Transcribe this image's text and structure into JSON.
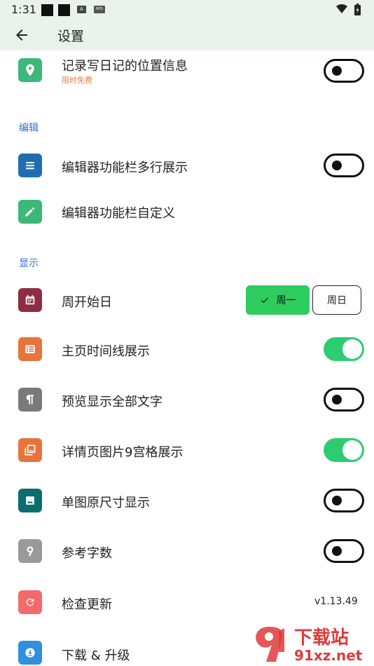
{
  "status": {
    "time": "1:31",
    "a_badge": "A",
    "rps_badge": "RPS"
  },
  "appbar": {
    "title": "设置"
  },
  "items": [
    {
      "label": "记录写日记的位置信息",
      "sub": "限时免费"
    },
    {
      "label": "编辑器功能栏多行展示"
    },
    {
      "label": "编辑器功能栏自定义"
    },
    {
      "label": "周开始日"
    },
    {
      "label": "主页时间线展示"
    },
    {
      "label": "预览显示全部文字"
    },
    {
      "label": "详情页图片9宫格展示"
    },
    {
      "label": "单图原尺寸显示"
    },
    {
      "label": "参考字数"
    },
    {
      "label": "检查更新"
    },
    {
      "label": "下载 & 升级"
    }
  ],
  "sections": {
    "edit": "编辑",
    "display": "显示"
  },
  "week_start": {
    "monday": "周一",
    "sunday": "周日",
    "selected": "周一"
  },
  "version": "v1.13.49",
  "toggles": {
    "location": false,
    "editor_multiline": false,
    "timeline": true,
    "preview_all": false,
    "grid9": true,
    "single_original": false,
    "word_count": false
  },
  "watermark": {
    "text_cn": "下载站",
    "text_url": "91xz.net"
  },
  "colors": {
    "green_tile": "#3cb878",
    "blue_tile": "#1f6fb0",
    "maroon_tile": "#8e2c42",
    "orange_tile": "#e8743b",
    "gray_tile": "#7a7a7a",
    "teal_tile": "#0b6e6e",
    "red_tile": "#f26b6b",
    "sky_tile": "#2f8fe0",
    "toggle_on": "#2ecc71",
    "section_blue": "#2d6fd1",
    "sub_orange": "#ef7d3c"
  }
}
